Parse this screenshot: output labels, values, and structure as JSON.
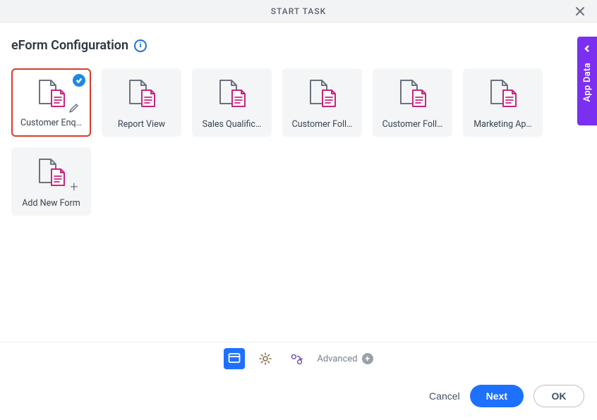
{
  "header": {
    "title": "START TASK"
  },
  "section": {
    "title": "eForm Configuration"
  },
  "cards": [
    {
      "label": "Customer Enq…",
      "selected": true,
      "edit": true
    },
    {
      "label": "Report View"
    },
    {
      "label": "Sales Qualific…"
    },
    {
      "label": "Customer Foll…"
    },
    {
      "label": "Customer Foll…"
    },
    {
      "label": "Marketing Ap…"
    }
  ],
  "add_card": {
    "label": "Add New Form"
  },
  "toolbar": {
    "advanced": "Advanced"
  },
  "footer": {
    "cancel": "Cancel",
    "next": "Next",
    "ok": "OK"
  },
  "side": {
    "label": "App Data"
  },
  "colors": {
    "accent_red": "#d83a2b",
    "primary_blue": "#1e70ff",
    "purple": "#7b2ff0",
    "magenta": "#c8247d"
  }
}
